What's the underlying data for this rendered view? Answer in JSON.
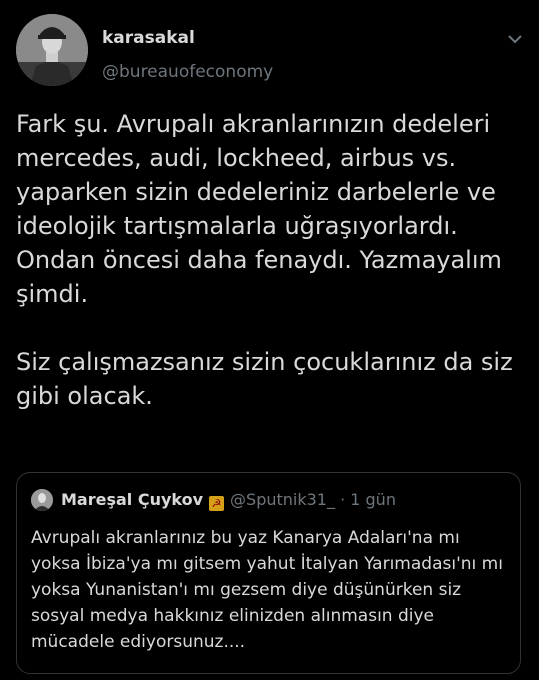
{
  "tweet": {
    "display_name": "karasakal",
    "handle": "@bureauofeconomy",
    "text": "Fark şu. Avrupalı akranlarınızın dedeleri mercedes, audi, lockheed, airbus vs. yaparken sizin dedeleriniz darbelerle ve ideolojik tartışmalarla uğraşıyorlardı. Ondan öncesi daha fenaydı. Yazmayalım şimdi.\n\nSiz çalışmazsanız sizin çocuklarınız da siz gibi olacak.",
    "menu_icon": "chevron-down-icon"
  },
  "quoted": {
    "display_name": "Mareşal Çuykov",
    "flag_icon": "☭",
    "handle": "@Sputnik31_",
    "separator": "·",
    "time": "1 gün",
    "text": "Avrupalı akranlarınız bu yaz Kanarya Adaları'na mı yoksa İbiza'ya mı gitsem yahut İtalyan Yarımadası'nı mı yoksa Yunanistan'ı mı gezsem diye düşünürken siz sosyal medya hakkınız elinizden alınmasın diye mücadele ediyorsunuz...."
  },
  "colors": {
    "background": "#000000",
    "text": "#d9d9d9",
    "muted": "#6e767d",
    "border": "#2f3336"
  }
}
